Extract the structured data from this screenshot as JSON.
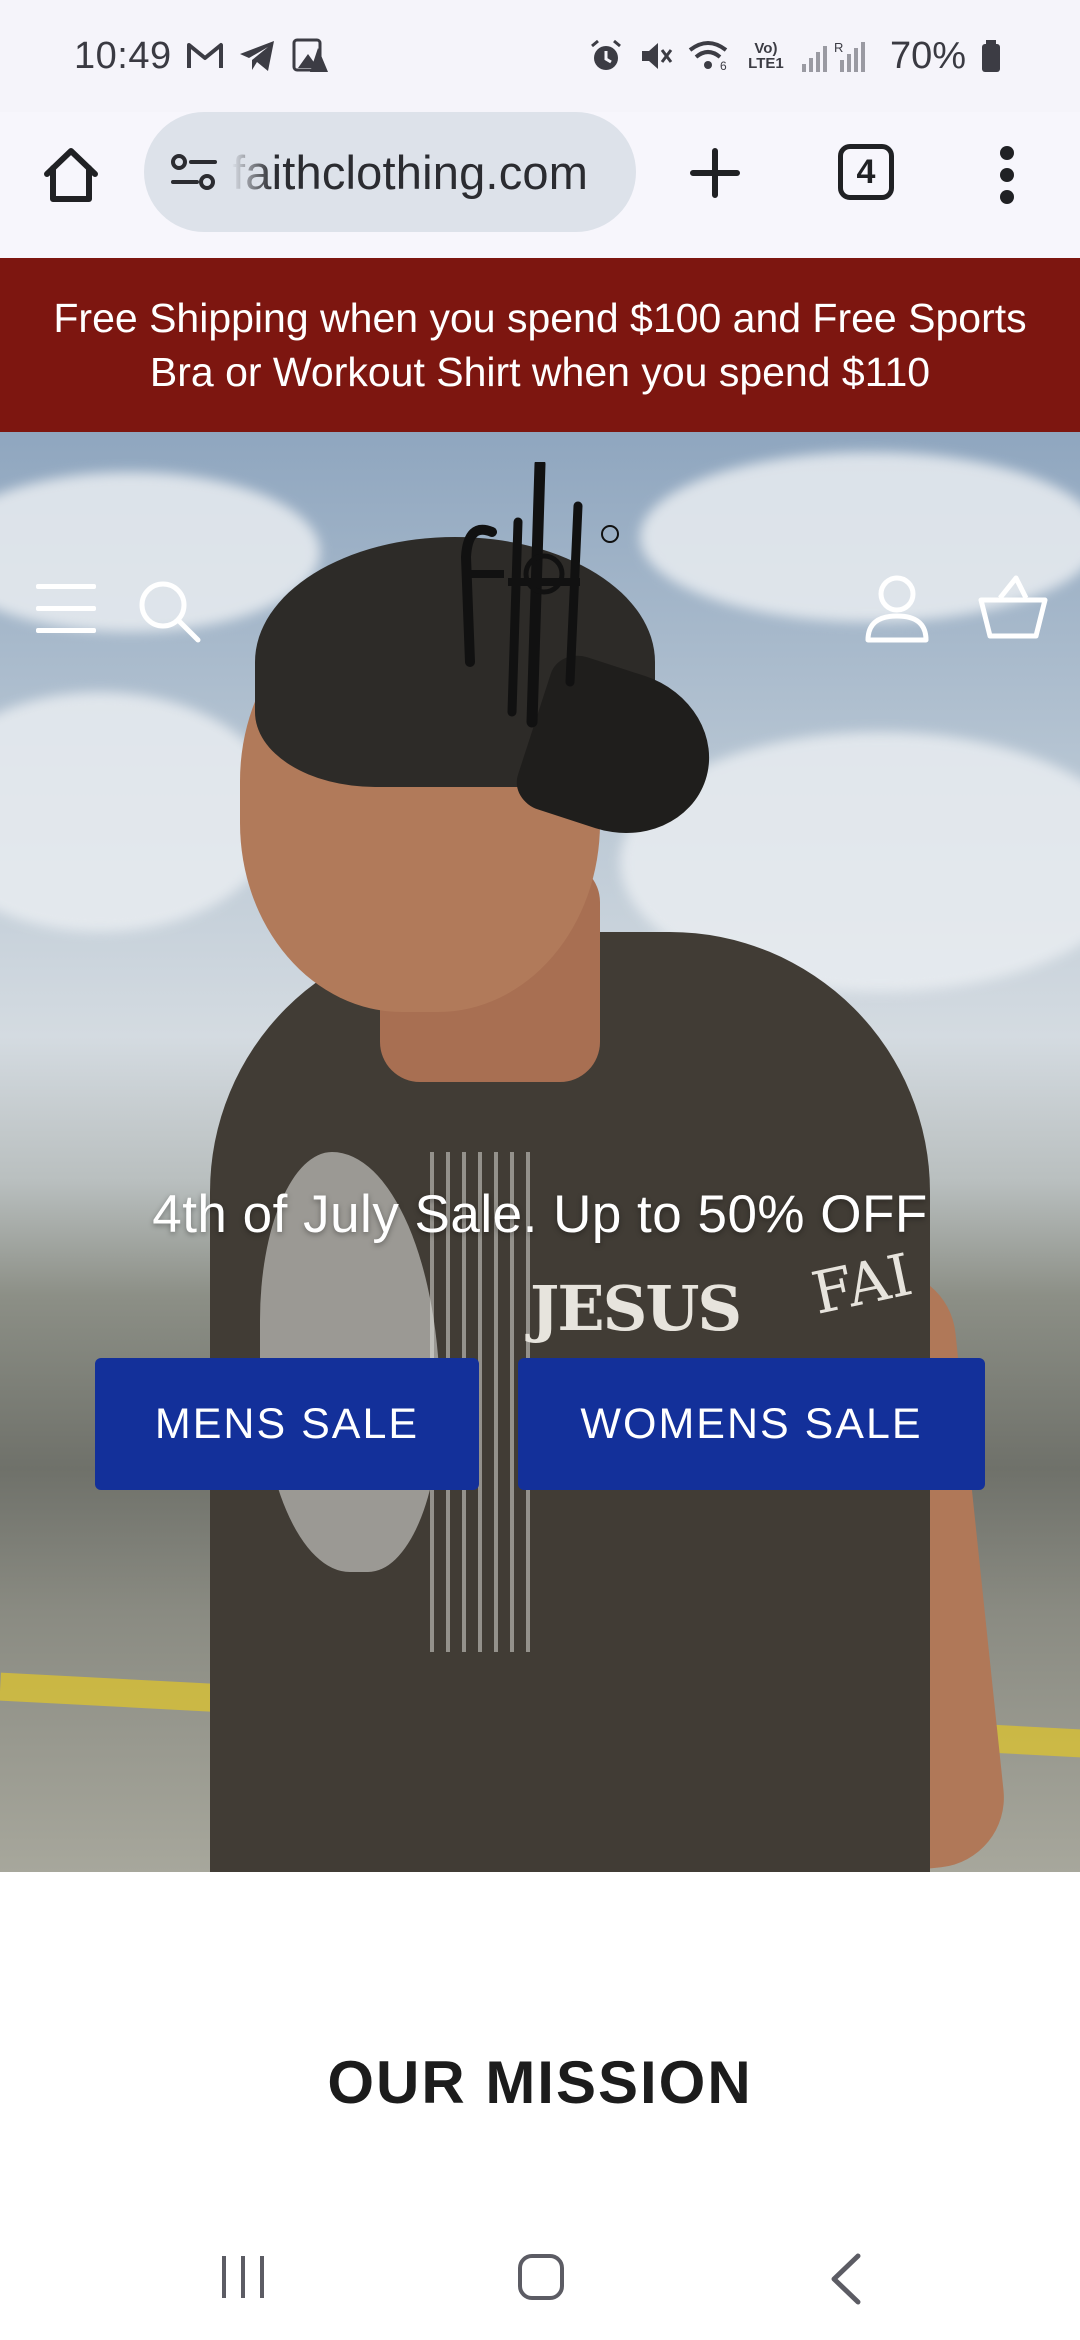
{
  "status_bar": {
    "time": "10:49",
    "battery": "70%",
    "network_label": "Vo) LTE1",
    "signal_label_1": "6",
    "signal_label_2": "R"
  },
  "browser": {
    "url": "faithclothing.com",
    "tab_count": "4"
  },
  "announcement": {
    "text": "Free Shipping when you spend $100 and Free Sports Bra or Workout Shirt when you spend $110"
  },
  "hero": {
    "heading": "4th of July Sale. Up to 50% OFF",
    "mens_button": "MENS SALE",
    "womens_button": "WOMENS SALE",
    "shirt_word": "JESUS",
    "sleeve_word": "FAI"
  },
  "mission": {
    "title": "OUR MISSION"
  },
  "colors": {
    "announcement_bg": "#7d1610",
    "cta_bg": "#13309a",
    "url_box_bg": "#dde2ea"
  },
  "icons": {
    "status_left": [
      "gmail-icon",
      "telegram-icon",
      "photo-app-icon"
    ],
    "status_right": [
      "alarm-icon",
      "mute-icon",
      "wifi-icon",
      "signal-icon",
      "battery-icon"
    ],
    "browser": [
      "home-icon",
      "site-settings-icon",
      "plus-icon",
      "more-vert-icon"
    ],
    "hero": [
      "hamburger-icon",
      "search-icon",
      "account-icon",
      "cart-icon"
    ],
    "navigation": [
      "recent-apps-icon",
      "home-nav-icon",
      "back-icon"
    ]
  }
}
